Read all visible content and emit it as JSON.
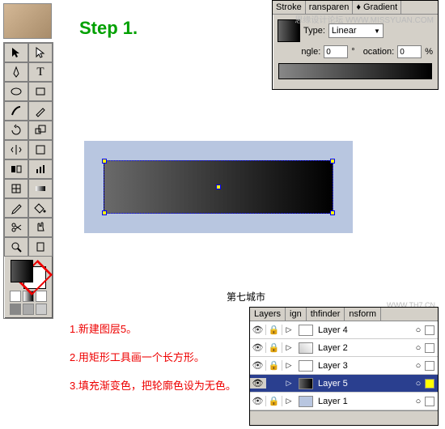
{
  "step_title": "Step 1.",
  "watermark1": "思缘设计论坛  WWW.MISSYUAN.COM",
  "city_label": "第七城市",
  "city_wm": "WWW.TH7.CN",
  "gradient_panel": {
    "tab1": "Stroke",
    "tab2": "ransparen",
    "tab3": "Gradient",
    "type_label": "Type:",
    "type_value": "Linear",
    "angle_label": "ngle:",
    "angle_value": "0",
    "location_label": "ocation:",
    "location_value": "0",
    "percent": "%",
    "deg": "°"
  },
  "instructions": {
    "line1": "1.新建图层5。",
    "line2": "2.用矩形工具画一个长方形。",
    "line3": "3.填充渐变色，把轮廓色设为无色。"
  },
  "layers_panel": {
    "tab1": "Layers",
    "tab2": "ign",
    "tab3": "thfinder",
    "tab4": "nsform",
    "rows": [
      {
        "name": "Layer 4",
        "sel": false,
        "thumb": "#fff"
      },
      {
        "name": "Layer 2",
        "sel": false,
        "thumb": "#ddd"
      },
      {
        "name": "Layer 3",
        "sel": false,
        "thumb": "#fff"
      },
      {
        "name": "Layer 5",
        "sel": true,
        "thumb": "#333"
      },
      {
        "name": "Layer 1",
        "sel": false,
        "thumb": "#b8c6e0"
      }
    ]
  },
  "colors": {
    "accent_green": "#00a000",
    "accent_red": "#e00",
    "canvas_bg": "#b8c6e0",
    "panel": "#d4d0c8",
    "selection": "#2a3f8f"
  }
}
